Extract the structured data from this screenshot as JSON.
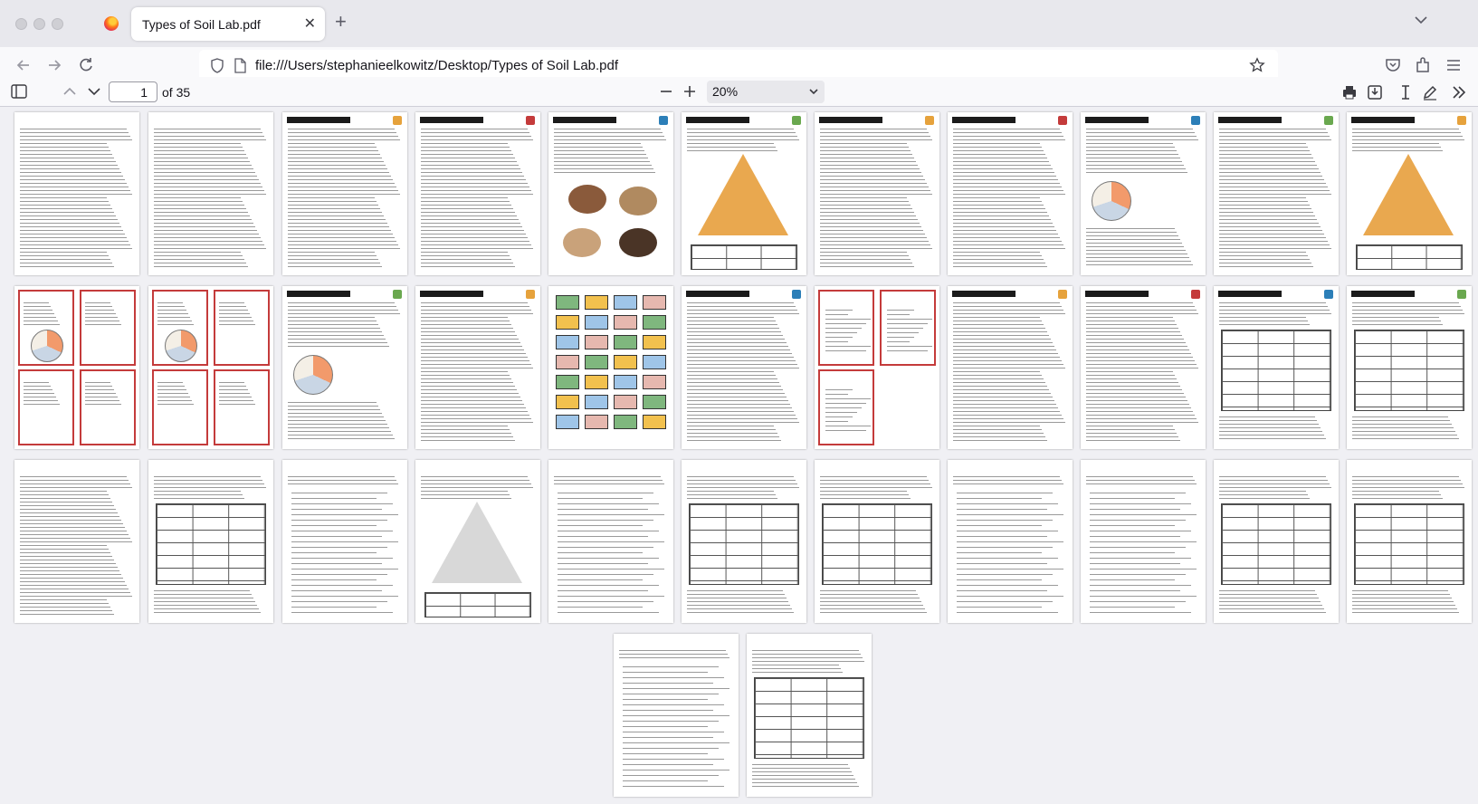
{
  "browser": {
    "tab_title": "Types of Soil Lab.pdf",
    "tab_close_icon": "close-icon",
    "new_tab_icon": "plus-icon",
    "url": "file:///Users/stephanieelkowitz/Desktop/Types of Soil Lab.pdf"
  },
  "pdf_toolbar": {
    "page_number": "1",
    "page_total": "of 35",
    "zoom_level": "20%"
  },
  "document": {
    "visible_pages": 35,
    "page_headers": [
      "",
      "",
      "Science Skills Station",
      "Science Skills Station",
      "Science Skills Station",
      "Science Skills Station",
      "Science Skills Station",
      "Narrative Station",
      "Narrative Station",
      "Narrative Station",
      "Assessment Station",
      "Question #1",
      "Question #5",
      "Problem Solving Station",
      "Problem Solving Station",
      "",
      "Problem Solving Station",
      "Problem #1",
      "Problem Solving Station",
      "Synthesis Station",
      "Synthesis Project",
      "Synthesis Project",
      "",
      "",
      "",
      "",
      "",
      "",
      "",
      "",
      "",
      "",
      "",
      "",
      ""
    ]
  },
  "colors": {
    "tabstrip_bg": "#e8e8ed",
    "toolbar_bg": "#f9f9fb",
    "viewer_bg": "#f0f0f4",
    "red_card_border": "#c43b3b"
  }
}
